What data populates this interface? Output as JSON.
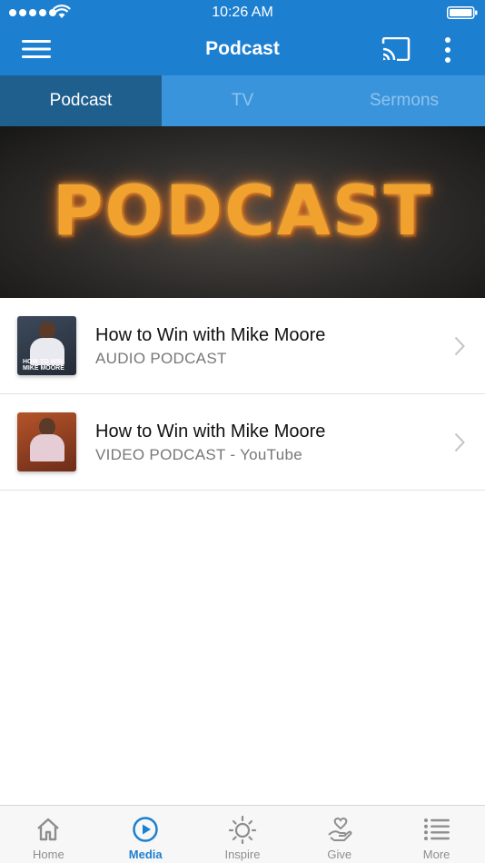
{
  "status": {
    "time": "10:26 AM"
  },
  "nav": {
    "title": "Podcast",
    "menu_icon": "hamburger-menu-icon",
    "cast_icon": "cast-icon",
    "more_icon": "kebab-menu-icon"
  },
  "tabs": [
    {
      "label": "Podcast",
      "active": true
    },
    {
      "label": "TV",
      "active": false
    },
    {
      "label": "Sermons",
      "active": false
    }
  ],
  "banner": {
    "text": "PODCAST"
  },
  "items": [
    {
      "title": "How to Win with Mike Moore",
      "subtitle": "AUDIO PODCAST",
      "thumb_label": "HOW TO WIN MIKE MOORE"
    },
    {
      "title": "How to Win with Mike Moore",
      "subtitle": "VIDEO PODCAST - YouTube",
      "thumb_label": ""
    }
  ],
  "tabbar": [
    {
      "label": "Home",
      "icon": "home-icon",
      "active": false
    },
    {
      "label": "Media",
      "icon": "play-circle-icon",
      "active": true
    },
    {
      "label": "Inspire",
      "icon": "sun-icon",
      "active": false
    },
    {
      "label": "Give",
      "icon": "heart-hand-icon",
      "active": false
    },
    {
      "label": "More",
      "icon": "list-icon",
      "active": false
    }
  ],
  "colors": {
    "primary": "#1d7fd0",
    "tab_active": "#1f5f8e",
    "tab_inactive": "#3a94db"
  }
}
